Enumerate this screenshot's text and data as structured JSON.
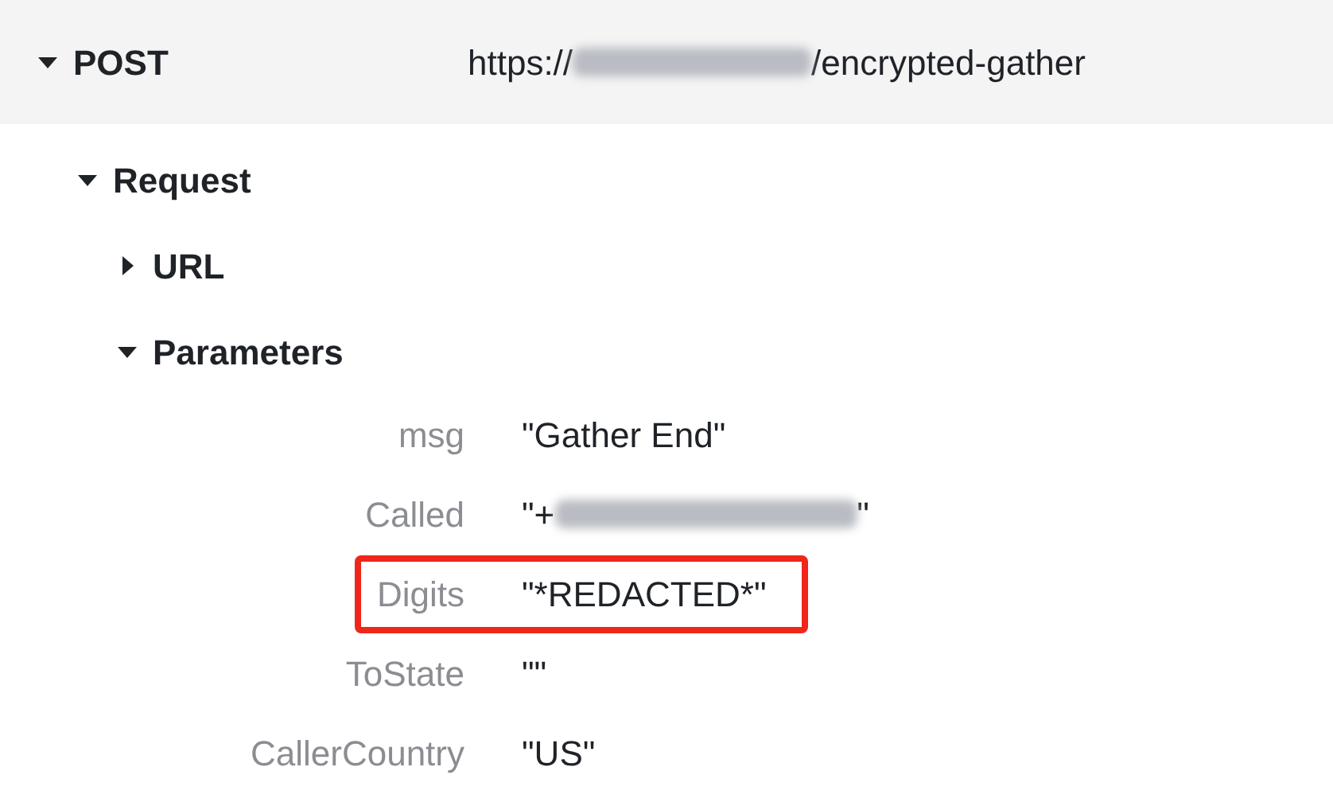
{
  "request_line": {
    "method": "POST",
    "expanded": true,
    "url": {
      "prefix": "https://",
      "redacted": true,
      "suffix": "/encrypted-gather"
    }
  },
  "tree": [
    {
      "label": "Request",
      "expanded": true,
      "children": [
        {
          "label": "URL",
          "expanded": false
        },
        {
          "label": "Parameters",
          "expanded": true,
          "params": [
            {
              "key": "msg",
              "value": "\"Gather End\"",
              "highlighted": false
            },
            {
              "key": "Called",
              "value": "\"+",
              "redacted": true,
              "value_end": "\"",
              "highlighted": false
            },
            {
              "key": "Digits",
              "value": "\"*REDACTED*\"",
              "highlighted": true
            },
            {
              "key": "ToState",
              "value": "\"\"",
              "highlighted": false
            },
            {
              "key": "CallerCountry",
              "value": "\"US\"",
              "highlighted": false
            }
          ]
        }
      ]
    }
  ]
}
